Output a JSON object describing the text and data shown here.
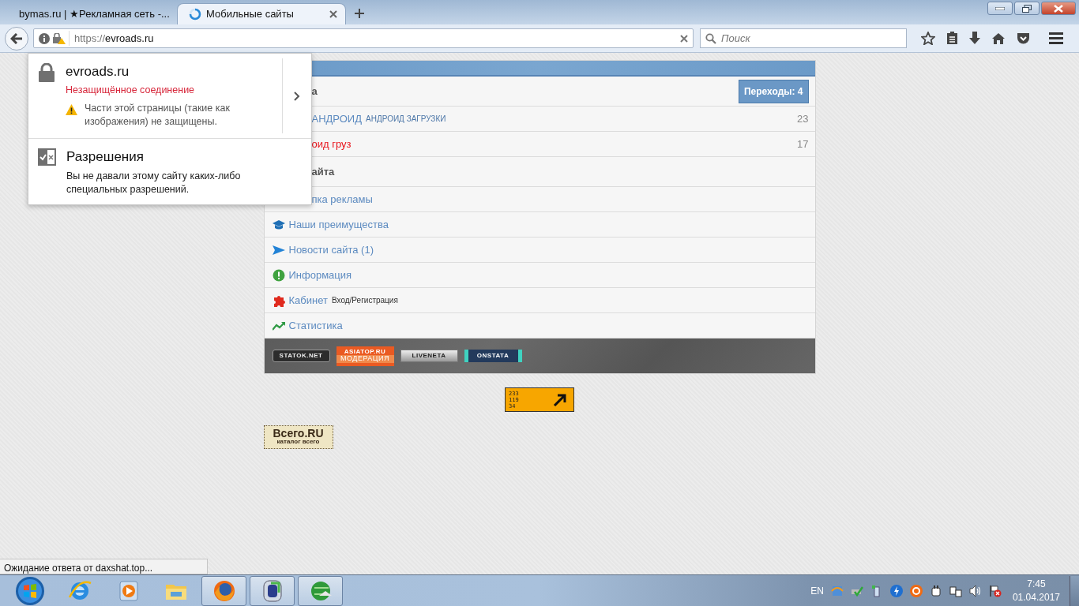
{
  "browser": {
    "tabs": [
      {
        "title": "bymas.ru | ★Рекламная сеть -...",
        "selected": false,
        "loading": false
      },
      {
        "title": "Мобильные сайты",
        "selected": true,
        "loading": true
      }
    ],
    "url_scheme": "https://",
    "url_host": "evroads.ru",
    "search": {
      "placeholder": "Поиск"
    }
  },
  "site_popup": {
    "domain": "evroads.ru",
    "connection": "Незащищённое соединение",
    "warning": "Части этой страницы (такие как изображения) не защищены.",
    "permissions_title": "Разрешения",
    "permissions_text": "Вы не давали этому сайту каких-либо специальных разрешений."
  },
  "page": {
    "rows": [
      {
        "kind": "heading",
        "text": "а",
        "badge": "Переходы: 4"
      },
      {
        "kind": "link",
        "text": "АНДРОИД",
        "sub": "АНДРОИД ЗАГРУЗКИ",
        "count": "23"
      },
      {
        "kind": "alert",
        "text": "оид груз",
        "count": "17"
      },
      {
        "kind": "heading",
        "text": "айта"
      },
      {
        "kind": "link",
        "text": "пка рекламы"
      },
      {
        "kind": "advantages",
        "text": "Наши преимущества"
      },
      {
        "kind": "news",
        "text": "Новости сайта (1)"
      },
      {
        "kind": "info",
        "text": "Информация"
      },
      {
        "kind": "cabinet",
        "text": "Кабинет",
        "sub": "Вход/Регистрация"
      },
      {
        "kind": "stats",
        "text": "Статистика"
      }
    ],
    "counters": [
      {
        "kind": "statok",
        "text": "STATOK.NET"
      },
      {
        "kind": "asiatop",
        "text": "ASIATOP.RU",
        "sub": "МОДЕРАЦИЯ"
      },
      {
        "kind": "liveneta",
        "text": "LIVENETA"
      },
      {
        "kind": "onstata",
        "text": "ONSTATA"
      }
    ],
    "hit_counter": {
      "lines": [
        "233",
        "119",
        "34"
      ]
    },
    "catalog_banner": {
      "title": "Всего.RU",
      "subtitle": "каталог всего"
    }
  },
  "status_text": "Ожидание ответа от daxshat.top...",
  "taskbar": {
    "apps": [
      {
        "kind": "ie",
        "running": false
      },
      {
        "kind": "media",
        "running": false
      },
      {
        "kind": "explorer",
        "running": false
      },
      {
        "kind": "firefox",
        "running": true
      },
      {
        "kind": "bluebox",
        "running": true
      },
      {
        "kind": "greenglobe",
        "running": true
      }
    ],
    "language": "EN",
    "time": "7:45",
    "date": "01.04.2017"
  }
}
